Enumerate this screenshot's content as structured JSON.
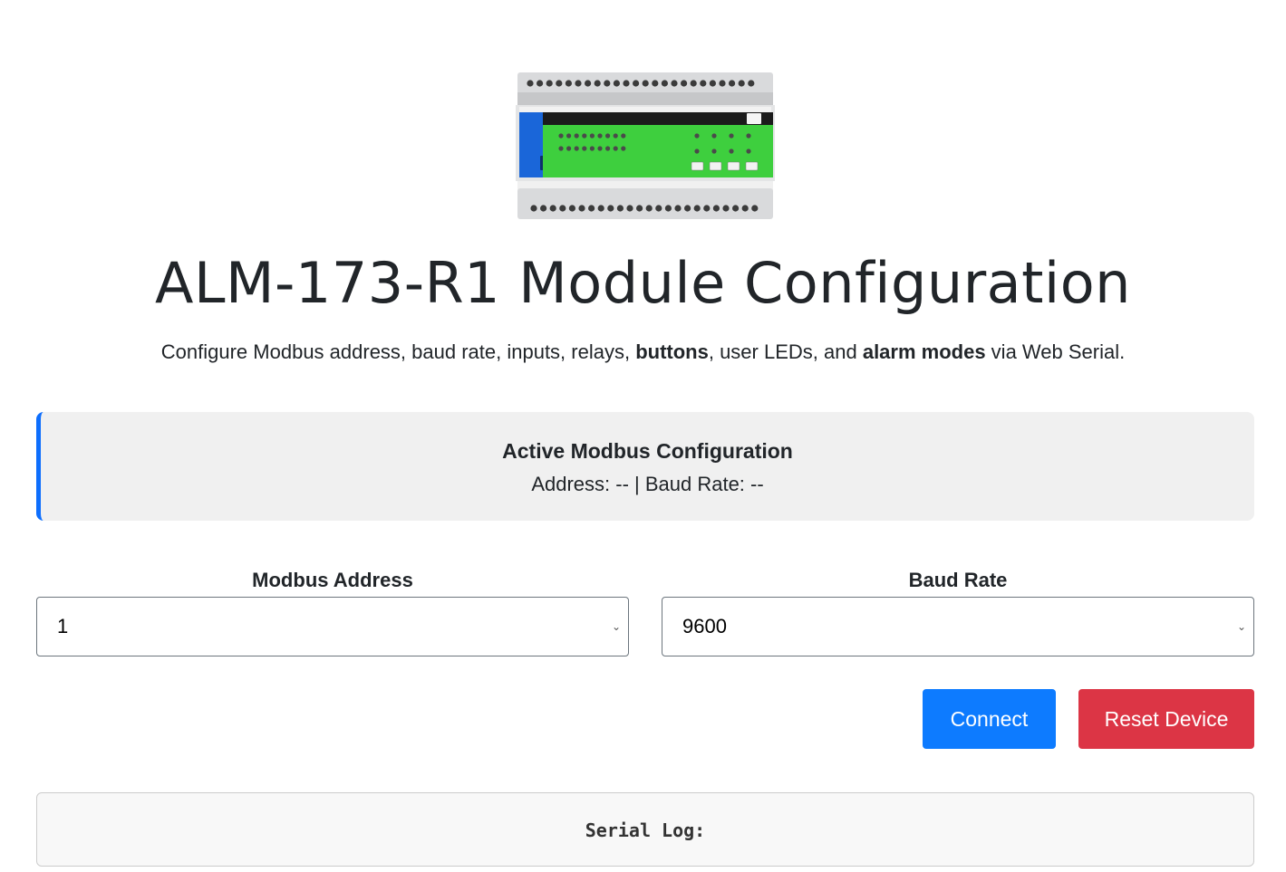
{
  "page": {
    "title": "ALM-173-R1 Module Configuration",
    "subtitle_parts": [
      {
        "text": "Configure Modbus address, baud rate, inputs, relays, ",
        "bold": false
      },
      {
        "text": "buttons",
        "bold": true
      },
      {
        "text": ", user LEDs, and ",
        "bold": false
      },
      {
        "text": "alarm modes",
        "bold": true
      },
      {
        "text": " via Web Serial.",
        "bold": false
      }
    ]
  },
  "active_config": {
    "heading": "Active Modbus Configuration",
    "status": "Address: -- | Baud Rate: --"
  },
  "form": {
    "address_label": "Modbus Address",
    "address_value": "1",
    "baud_label": "Baud Rate",
    "baud_value": "9600"
  },
  "buttons": {
    "connect": "Connect",
    "reset": "Reset Device"
  },
  "serial_log": {
    "title": "Serial Log:"
  },
  "colors": {
    "accent": "#0d6efd",
    "connect": "#0d7bff",
    "reset": "#dc3545",
    "panel": "#f0f0f0",
    "device_green": "#3ecf3e",
    "device_blue": "#1a66d9"
  },
  "icons": {
    "select_chevron": "chevron-down-icon"
  }
}
